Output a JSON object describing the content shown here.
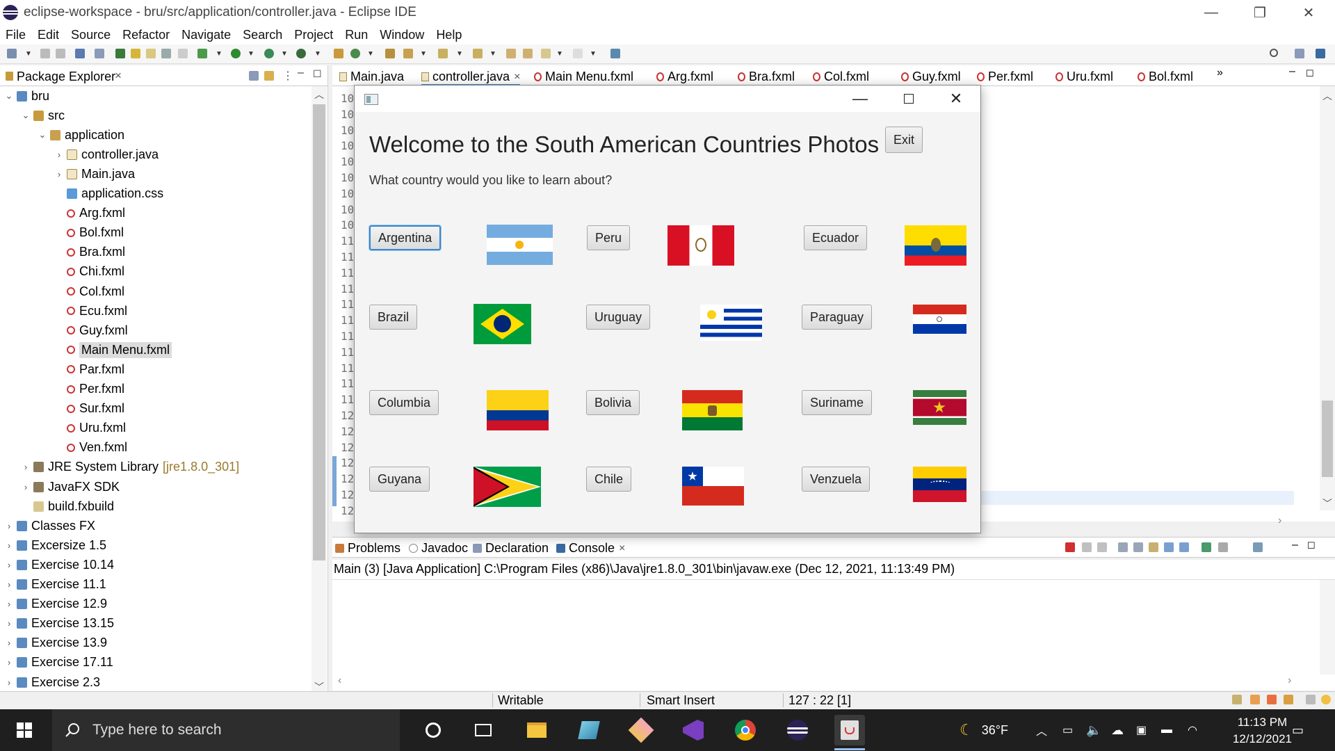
{
  "window": {
    "title": "eclipse-workspace - bru/src/application/controller.java - Eclipse IDE",
    "minimize": "—",
    "restore": "❐",
    "close": "✕"
  },
  "menu": [
    "File",
    "Edit",
    "Source",
    "Refactor",
    "Navigate",
    "Search",
    "Project",
    "Run",
    "Window",
    "Help"
  ],
  "package_explorer": {
    "title": "Package Explorer",
    "tree": [
      {
        "label": "bru",
        "chev": "⌄",
        "icon": "project",
        "decoration": ""
      },
      {
        "label": "src",
        "chev": "⌄",
        "icon": "folder",
        "decoration": ""
      },
      {
        "label": "application",
        "chev": "⌄",
        "icon": "package",
        "decoration": ""
      },
      {
        "label": "controller.java",
        "chev": "›",
        "icon": "java",
        "decoration": ""
      },
      {
        "label": "Main.java",
        "chev": "›",
        "icon": "java",
        "decoration": ""
      },
      {
        "label": "application.css",
        "chev": "",
        "icon": "css",
        "decoration": ""
      },
      {
        "label": "Arg.fxml",
        "chev": "",
        "icon": "fxml",
        "decoration": ""
      },
      {
        "label": "Bol.fxml",
        "chev": "",
        "icon": "fxml",
        "decoration": ""
      },
      {
        "label": "Bra.fxml",
        "chev": "",
        "icon": "fxml",
        "decoration": ""
      },
      {
        "label": "Chi.fxml",
        "chev": "",
        "icon": "fxml",
        "decoration": ""
      },
      {
        "label": "Col.fxml",
        "chev": "",
        "icon": "fxml",
        "decoration": ""
      },
      {
        "label": "Ecu.fxml",
        "chev": "",
        "icon": "fxml",
        "decoration": ""
      },
      {
        "label": "Guy.fxml",
        "chev": "",
        "icon": "fxml",
        "decoration": ""
      },
      {
        "label": "Main Menu.fxml",
        "chev": "",
        "icon": "fxml",
        "decoration": "",
        "selected": true
      },
      {
        "label": "Par.fxml",
        "chev": "",
        "icon": "fxml",
        "decoration": ""
      },
      {
        "label": "Per.fxml",
        "chev": "",
        "icon": "fxml",
        "decoration": ""
      },
      {
        "label": "Sur.fxml",
        "chev": "",
        "icon": "fxml",
        "decoration": ""
      },
      {
        "label": "Uru.fxml",
        "chev": "",
        "icon": "fxml",
        "decoration": ""
      },
      {
        "label": "Ven.fxml",
        "chev": "",
        "icon": "fxml",
        "decoration": ""
      },
      {
        "label": "JRE System Library",
        "chev": "›",
        "icon": "library",
        "decoration": "[jre1.8.0_301]"
      },
      {
        "label": "JavaFX SDK",
        "chev": "›",
        "icon": "library",
        "decoration": ""
      },
      {
        "label": "build.fxbuild",
        "chev": "",
        "icon": "build",
        "decoration": ""
      },
      {
        "label": "Classes FX",
        "chev": "›",
        "icon": "project",
        "decoration": ""
      },
      {
        "label": "Excersize 1.5",
        "chev": "›",
        "icon": "project",
        "decoration": ""
      },
      {
        "label": "Exercise 10.14",
        "chev": "›",
        "icon": "project",
        "decoration": ""
      },
      {
        "label": "Exercise 11.1",
        "chev": "›",
        "icon": "project",
        "decoration": ""
      },
      {
        "label": "Exercise 12.9",
        "chev": "›",
        "icon": "project",
        "decoration": ""
      },
      {
        "label": "Exercise 13.15",
        "chev": "›",
        "icon": "project",
        "decoration": ""
      },
      {
        "label": "Exercise 13.9",
        "chev": "›",
        "icon": "project",
        "decoration": ""
      },
      {
        "label": "Exercise 17.11",
        "chev": "›",
        "icon": "project",
        "decoration": ""
      },
      {
        "label": "Exercise 2.3",
        "chev": "›",
        "icon": "project",
        "decoration": ""
      }
    ]
  },
  "editor_tabs": [
    {
      "label": "Main.java",
      "type": "java"
    },
    {
      "label": "controller.java",
      "type": "java",
      "active": true,
      "close": "×"
    },
    {
      "label": "Main Menu.fxml",
      "type": "fxml"
    },
    {
      "label": "Arg.fxml",
      "type": "fxml"
    },
    {
      "label": "Bra.fxml",
      "type": "fxml"
    },
    {
      "label": "Col.fxml",
      "type": "fxml"
    },
    {
      "label": "Guy.fxml",
      "type": "fxml"
    },
    {
      "label": "Per.fxml",
      "type": "fxml"
    },
    {
      "label": "Uru.fxml",
      "type": "fxml"
    },
    {
      "label": "Bol.fxml",
      "type": "fxml"
    }
  ],
  "editor_overflow": "»",
  "line_numbers": [
    "10",
    "10",
    "10",
    "10",
    "10",
    "10",
    "10",
    "10",
    "10",
    "11",
    "11",
    "11",
    "11",
    "11",
    "11",
    "11",
    "11",
    "11",
    "11",
    "11",
    "12",
    "12",
    "12",
    "12",
    "12",
    "12",
    "12",
    "12"
  ],
  "console": {
    "tabs": [
      "Problems",
      "Javadoc",
      "Declaration",
      "Console"
    ],
    "header": "Main (3) [Java Application] C:\\Program Files (x86)\\Java\\jre1.8.0_301\\bin\\javaw.exe  (Dec 12, 2021, 11:13:49 PM)"
  },
  "status": {
    "writable": "Writable",
    "insert_mode": "Smart Insert",
    "position": "127 : 22 [1]"
  },
  "fx_app": {
    "heading": "Welcome to the South American Countries Photos",
    "subheading": "What country would you like to learn about?",
    "exit": "Exit",
    "countries": [
      "Argentina",
      "Peru",
      "Ecuador",
      "Brazil",
      "Uruguay",
      "Paraguay",
      "Columbia",
      "Bolivia",
      "Suriname",
      "Guyana",
      "Chile",
      "Venzuela"
    ]
  },
  "taskbar": {
    "search_placeholder": "Type here to search",
    "weather": "36°F",
    "time": "11:13 PM",
    "date": "12/12/2021"
  }
}
